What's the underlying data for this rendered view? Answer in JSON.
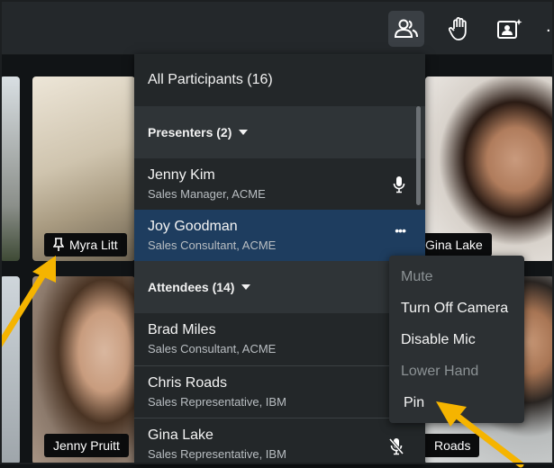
{
  "toolbar": {
    "participants_icon": "participants-icon",
    "raise_hand_icon": "raise-hand-icon",
    "contact_card_icon": "contact-card-icon",
    "more_icon": "more-icon",
    "more_glyph": "."
  },
  "tiles": [
    {
      "name": "Myra Litt",
      "pinned": true
    },
    {
      "name": "Gina Lake"
    },
    {
      "name": "Jenny Pruitt"
    },
    {
      "name": "Roads"
    }
  ],
  "panel": {
    "title": "All Participants (16)",
    "presenters_label": "Presenters (2)",
    "presenters": [
      {
        "name": "Jenny Kim",
        "subtitle": "Sales Manager, ACME",
        "status_icon": "microphone-icon"
      },
      {
        "name": "Joy Goodman",
        "subtitle": "Sales Consultant, ACME",
        "status_icon": "more-options-icon",
        "more_glyph": "•••"
      }
    ],
    "attendees_label": "Attendees (14)",
    "attendees": [
      {
        "name": "Brad Miles",
        "subtitle": "Sales Consultant, ACME"
      },
      {
        "name": "Chris Roads",
        "subtitle": "Sales Representative, IBM"
      },
      {
        "name": "Gina Lake",
        "subtitle": "Sales Representative, IBM",
        "status_icon": "microphone-muted-icon"
      }
    ]
  },
  "context_menu": {
    "items": [
      {
        "label": "Mute",
        "enabled": false
      },
      {
        "label": "Turn Off Camera",
        "enabled": true
      },
      {
        "label": "Disable Mic",
        "enabled": true
      },
      {
        "label": "Lower Hand",
        "enabled": false
      },
      {
        "label": "Pin",
        "enabled": true
      }
    ]
  },
  "colors": {
    "panel_bg": "#232729",
    "section_bg": "#2f3437",
    "selected_row": "#1e3d5f",
    "arrow": "#f5b400"
  }
}
